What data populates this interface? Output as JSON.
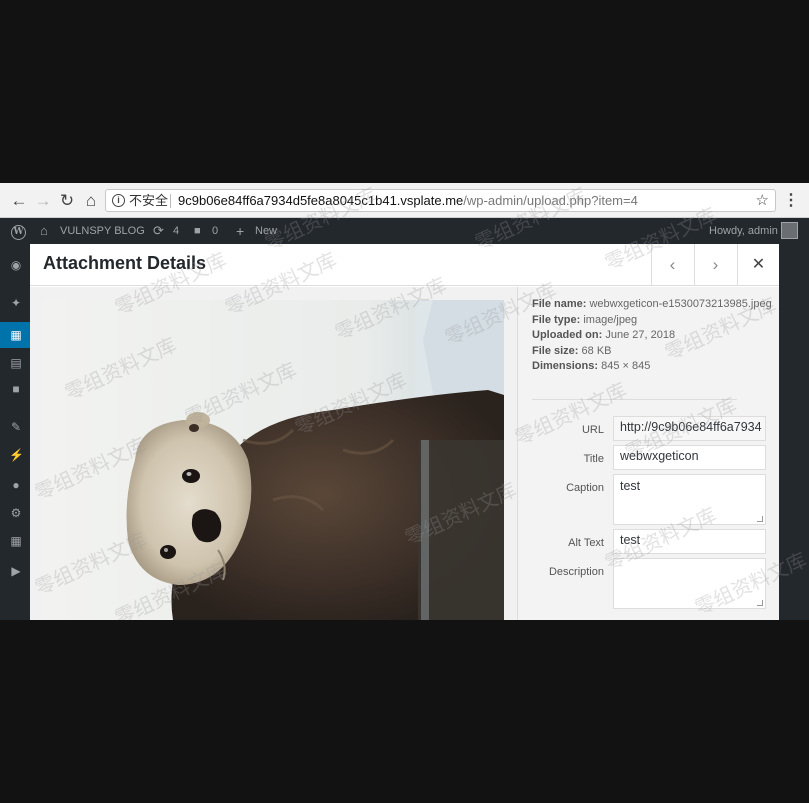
{
  "browser": {
    "security_label": "不安全",
    "url_host": "9c9b06e84ff6a7934d5fe8a8045c1b41.vsplate.me",
    "url_path": "/wp-admin/upload.php?item=4",
    "icons": [
      "back-icon",
      "forward-icon",
      "reload-icon",
      "home-icon",
      "info-icon",
      "star-icon",
      "menu-icon"
    ]
  },
  "admin_bar": {
    "site_name": "VULNSPY BLOG",
    "updates_count": "4",
    "comments_count": "0",
    "new_label": "New",
    "howdy": "Howdy, admin"
  },
  "modal": {
    "title": "Attachment Details",
    "file_info": {
      "file_name_label": "File name:",
      "file_name": "webwxgeticon-e1530073213985.jpeg",
      "file_type_label": "File type:",
      "file_type": "image/jpeg",
      "uploaded_label": "Uploaded on:",
      "uploaded": "June 27, 2018",
      "file_size_label": "File size:",
      "file_size": "68 KB",
      "dimensions_label": "Dimensions:",
      "dimensions": "845 × 845"
    },
    "fields": {
      "url_label": "URL",
      "url_value": "http://9c9b06e84ff6a7934",
      "title_label": "Title",
      "title_value": "webwxgeticon",
      "caption_label": "Caption",
      "caption_value": "test",
      "alt_label": "Alt Text",
      "alt_value": "test",
      "description_label": "Description",
      "description_value": ""
    }
  },
  "watermark_text": "零组资料文库",
  "colors": {
    "admin_bar_bg": "#23282d",
    "active_menu": "#0073aa"
  }
}
